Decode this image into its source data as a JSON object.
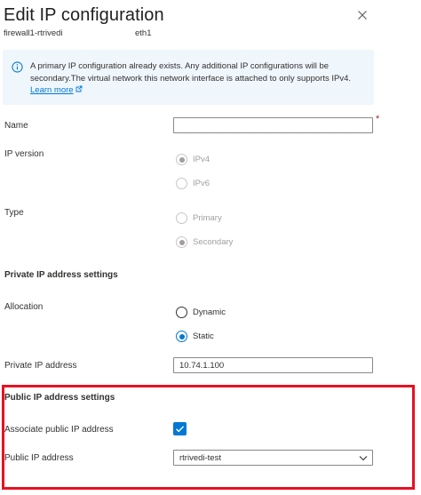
{
  "header": {
    "title": "Edit IP configuration",
    "resource_name": "firewall1-rtrivedi",
    "nic_name": "eth1",
    "close_icon": "close-icon"
  },
  "banner": {
    "icon": "info-icon",
    "text": "A primary IP configuration already exists. Any additional IP configurations will be secondary.The virtual network this network interface is attached to only supports IPv4.",
    "link_text": "Learn more",
    "link_icon": "external-link-icon"
  },
  "form": {
    "name": {
      "label": "Name",
      "value": "",
      "required_mark": "*"
    },
    "ip_version": {
      "label": "IP version",
      "options": [
        {
          "label": "IPv4",
          "selected": true,
          "disabled": true
        },
        {
          "label": "IPv6",
          "selected": false,
          "disabled": true
        }
      ]
    },
    "type": {
      "label": "Type",
      "options": [
        {
          "label": "Primary",
          "selected": false,
          "disabled": true
        },
        {
          "label": "Secondary",
          "selected": true,
          "disabled": true
        }
      ]
    },
    "private_section": "Private IP address settings",
    "allocation": {
      "label": "Allocation",
      "options": [
        {
          "label": "Dynamic",
          "selected": false,
          "disabled": false
        },
        {
          "label": "Static",
          "selected": true,
          "disabled": false
        }
      ]
    },
    "private_ip": {
      "label": "Private IP address",
      "value": "10.74.1.100"
    },
    "public_section": "Public IP address settings",
    "associate_public_ip": {
      "label": "Associate public IP address",
      "checked": true
    },
    "public_ip": {
      "label": "Public IP address",
      "value": "rtrivedi-test"
    }
  },
  "colors": {
    "accent": "#0078d4",
    "highlight_border": "#e81123",
    "banner_bg": "#eff6fc",
    "required": "#a4262c"
  }
}
